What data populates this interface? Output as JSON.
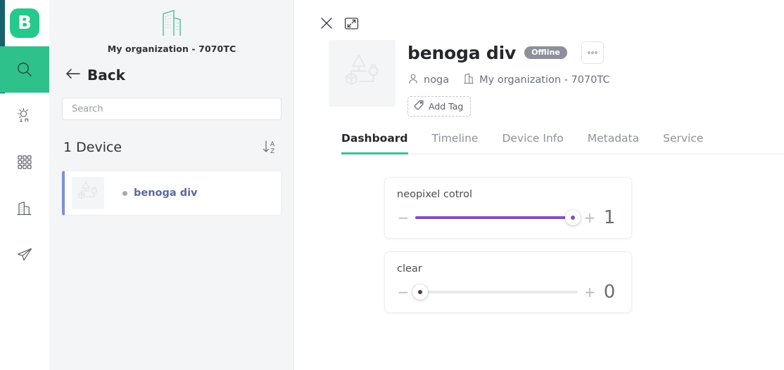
{
  "rail": {
    "logo_text": "B",
    "items": [
      {
        "name": "search-icon",
        "label": "Search",
        "active": true
      },
      {
        "name": "things-icon",
        "label": "Things",
        "active": false
      },
      {
        "name": "grid-apps-icon",
        "label": "Applications",
        "active": false
      },
      {
        "name": "organizations-icon",
        "label": "Organizations",
        "active": false
      },
      {
        "name": "send-paper-plane-icon",
        "label": "Messages",
        "active": false
      }
    ],
    "stripe_color": "#15616d",
    "active_color": "#2ec18b",
    "logo_color": "#25c98c"
  },
  "list_panel": {
    "organization_name": "My organization - 7070TC",
    "back_label": "Back",
    "search": {
      "value": "",
      "placeholder": "Search"
    },
    "count_label": "1 Device",
    "sort_icon_letters": {
      "top": "A",
      "bottom": "Z"
    },
    "devices": [
      {
        "name": "benoga div",
        "status": "offline",
        "selected": true
      }
    ],
    "selected_accent_color": "#7e90d6"
  },
  "main": {
    "close_icon": "close-icon",
    "expand_icon": "expand-icon",
    "device": {
      "title": "benoga div",
      "status_badge": "Offline",
      "more_button_label": "●●●",
      "owner": "noga",
      "organization": "My organization - 7070TC",
      "add_tag_label": "Add Tag"
    },
    "tabs": [
      {
        "label": "Dashboard",
        "active": true
      },
      {
        "label": "Timeline",
        "active": false
      },
      {
        "label": "Device Info",
        "active": false
      },
      {
        "label": "Metadata",
        "active": false
      },
      {
        "label": "Service",
        "active": false
      }
    ],
    "active_tab_underline_color": "#3fbf99",
    "widgets": [
      {
        "title": "neopixel cotrol",
        "value": "1",
        "percent": 97,
        "fill_color": "#8250c4",
        "knob_dot_color": "#8250c4",
        "minus_label": "−",
        "plus_label": "+"
      },
      {
        "title": "clear",
        "value": "0",
        "percent": 3,
        "fill_color": "#e8e9eb",
        "knob_dot_color": "#4d4336",
        "minus_label": "−",
        "plus_label": "+"
      }
    ]
  }
}
